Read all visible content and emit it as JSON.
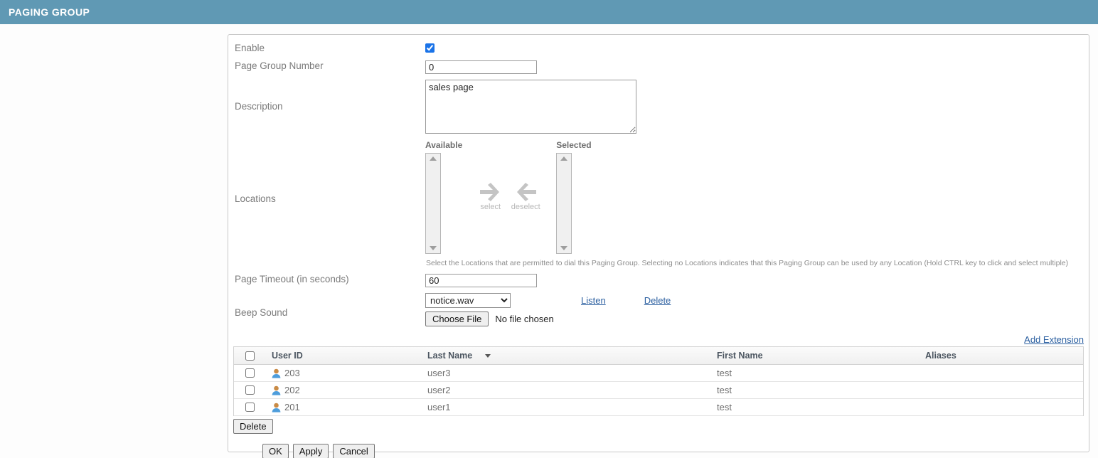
{
  "header": {
    "title": "PAGING GROUP",
    "bar_color": "#6099b4"
  },
  "form": {
    "enable": {
      "label": "Enable",
      "checked": true
    },
    "page_group_number": {
      "label": "Page Group Number",
      "value": "0"
    },
    "description": {
      "label": "Description",
      "value": "sales page",
      "placeholder": ""
    },
    "locations": {
      "label": "Locations",
      "available_label": "Available",
      "selected_label": "Selected",
      "select_label": "select",
      "deselect_label": "deselect",
      "available_items": [],
      "selected_items": [],
      "hint": "Select the Locations that are permitted to dial this Paging Group. Selecting no Locations indicates that this Paging Group can be used by any Location (Hold CTRL key to click and select multiple)"
    },
    "page_timeout": {
      "label": "Page Timeout (in seconds)",
      "value": "60"
    },
    "beep_sound": {
      "label": "Beep Sound",
      "selected_option": "notice.wav",
      "options": [
        "notice.wav"
      ],
      "listen_link": "Listen",
      "delete_link": "Delete",
      "choose_file_button": "Choose File",
      "file_status": "No file chosen"
    }
  },
  "extensions": {
    "add_link": "Add Extension",
    "columns": [
      "",
      "User ID",
      "Last Name",
      "First Name",
      "Aliases"
    ],
    "sorted_column": "Last Name",
    "rows": [
      {
        "selected": false,
        "user_id": "203",
        "last_name": "user3",
        "first_name": "test",
        "aliases": ""
      },
      {
        "selected": false,
        "user_id": "202",
        "last_name": "user2",
        "first_name": "test",
        "aliases": ""
      },
      {
        "selected": false,
        "user_id": "201",
        "last_name": "user1",
        "first_name": "test",
        "aliases": ""
      }
    ],
    "delete_button": "Delete"
  },
  "actions": {
    "ok": "OK",
    "apply": "Apply",
    "cancel": "Cancel"
  },
  "colors": {
    "header_bar": "#6099b4",
    "link": "#2b5fa0",
    "label_text": "#7a7a7a",
    "checkbox_accent": "#1a73e8"
  }
}
